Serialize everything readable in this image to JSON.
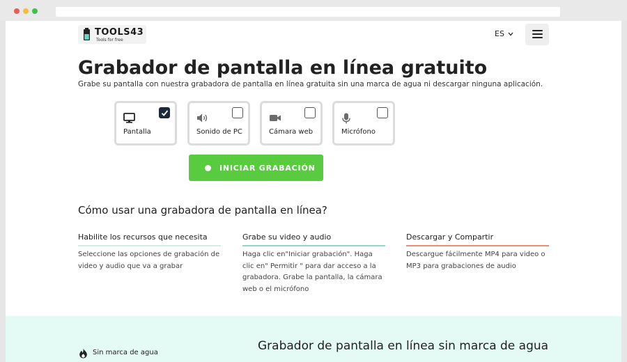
{
  "colors": {
    "accent_green": "#58cb3e",
    "step1_line": "#cdeee4",
    "step2_line": "#8fd8cc",
    "step3_line": "#f08b6e",
    "band_bg": "#e3fbf4"
  },
  "header": {
    "logo_text": "TOOLS43",
    "logo_tagline": "Tools for free",
    "language": "ES",
    "menu_icon": "hamburger-icon"
  },
  "hero": {
    "title": "Grabador de pantalla en línea gratuito",
    "subtitle": "Grabe su pantalla con nuestra grabadora de pantalla en línea gratuita sin una marca de agua ni descargar ninguna aplicación."
  },
  "options": [
    {
      "label": "Pantalla",
      "icon": "monitor-icon",
      "checked": true
    },
    {
      "label": "Sonido de PC",
      "icon": "speaker-icon",
      "checked": false
    },
    {
      "label": "Cámara web",
      "icon": "camera-icon",
      "checked": false
    },
    {
      "label": "Micrófono",
      "icon": "microphone-icon",
      "checked": false
    }
  ],
  "start_button": {
    "label": "INICIAR GRABACIÓN"
  },
  "how_to": {
    "title": "Cómo usar una grabadora de pantalla en línea?",
    "steps": [
      {
        "title": "Habilite los recursos que necesita",
        "text": "Seleccione las opciones de grabación de video y audio que va a grabar"
      },
      {
        "title": "Grabe su video y audio",
        "text": "Haga clic en\"Iniciar grabación\". Haga clic en\" Permitir \" para dar acceso a la grabadora. Grabe la pantalla, la cámara web o el micrófono"
      },
      {
        "title": "Descargar y Compartir",
        "text": "Descargue fácilmente MP4 para video o MP3 para grabaciones de audio"
      }
    ]
  },
  "feature_band": {
    "item_label": "Sin marca de agua",
    "item_icon": "flame-icon",
    "title": "Grabador de pantalla en línea sin marca de agua"
  }
}
